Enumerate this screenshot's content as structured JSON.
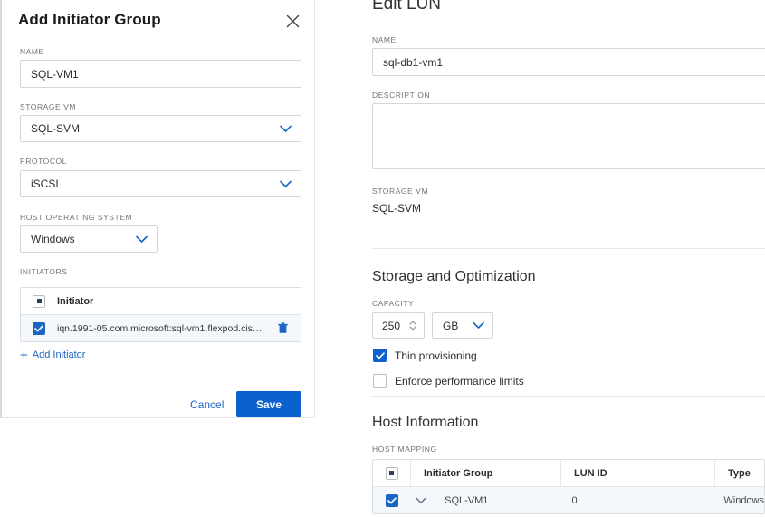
{
  "dialog": {
    "title": "Add Initiator Group",
    "close_icon": "close-icon",
    "fields": {
      "name_label": "NAME",
      "name_value": "SQL-VM1",
      "storage_vm_label": "STORAGE VM",
      "storage_vm_value": "SQL-SVM",
      "protocol_label": "PROTOCOL",
      "protocol_value": "iSCSI",
      "host_os_label": "HOST OPERATING SYSTEM",
      "host_os_value": "Windows",
      "initiators_label": "INITIATORS"
    },
    "initiators_table": {
      "header": "Initiator",
      "rows": [
        {
          "value": "iqn.1991-05.com.microsoft:sql-vm1.flexpod.cisco...."
        }
      ],
      "delete_icon": "trash-icon"
    },
    "add_initiator_label": "Add Initiator",
    "cancel_label": "Cancel",
    "save_label": "Save"
  },
  "edit_lun": {
    "title": "Edit LUN",
    "name_label": "NAME",
    "name_value": "sql-db1-vm1",
    "description_label": "DESCRIPTION",
    "description_value": "",
    "storage_vm_label": "STORAGE VM",
    "storage_vm_value": "SQL-SVM",
    "storage_section": {
      "heading": "Storage and Optimization",
      "capacity_label": "CAPACITY",
      "capacity_value": "250",
      "capacity_unit": "GB",
      "thin_provisioning_label": "Thin provisioning",
      "enforce_limits_label": "Enforce performance limits"
    },
    "host_section": {
      "heading": "Host Information",
      "host_mapping_label": "HOST MAPPING",
      "columns": [
        "Initiator Group",
        "LUN ID",
        "Type"
      ],
      "rows": [
        {
          "initiator_group": "SQL-VM1",
          "lun_id": "0",
          "type": "Windows"
        }
      ]
    }
  },
  "colors": {
    "accent_blue": "#0b62ce",
    "link_blue": "#1a65c4",
    "border_grey": "#d3d6d8",
    "row_highlight": "#f4f7fb"
  }
}
